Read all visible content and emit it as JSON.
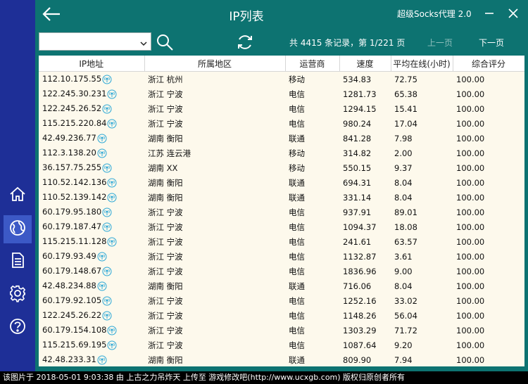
{
  "window": {
    "title": "IP列表",
    "app_name": "超级Socks代理 2.0"
  },
  "colors": {
    "sidebar": "#1e2f97",
    "header": "#0d7371",
    "row_bg": "#fdf9ec"
  },
  "sidebar": {
    "items": [
      {
        "name": "home-icon",
        "active": false
      },
      {
        "name": "globe-icon",
        "active": true
      },
      {
        "name": "document-icon",
        "active": false
      },
      {
        "name": "gear-icon",
        "active": false
      },
      {
        "name": "help-icon",
        "active": false
      }
    ]
  },
  "toolbar": {
    "filter_value": "",
    "record_info": "共 4415 条记录，第 1/221 页",
    "prev_label": "上一页",
    "next_label": "下一页"
  },
  "table": {
    "columns": [
      "IP地址",
      "所属地区",
      "运营商",
      "速度",
      "平均在线(小时)",
      "综合评分"
    ],
    "rows": [
      {
        "ip": "112.10.175.55",
        "region": "浙江 杭州",
        "isp": "移动",
        "speed": "534.83",
        "online": "72.75",
        "score": "100.00"
      },
      {
        "ip": "122.245.30.231",
        "region": "浙江 宁波",
        "isp": "电信",
        "speed": "1281.73",
        "online": "65.38",
        "score": "100.00"
      },
      {
        "ip": "122.245.26.52",
        "region": "浙江 宁波",
        "isp": "电信",
        "speed": "1294.15",
        "online": "15.41",
        "score": "100.00"
      },
      {
        "ip": "115.215.220.84",
        "region": "浙江 宁波",
        "isp": "电信",
        "speed": "980.24",
        "online": "17.04",
        "score": "100.00"
      },
      {
        "ip": "42.49.236.77",
        "region": "湖南 衡阳",
        "isp": "联通",
        "speed": "841.28",
        "online": "7.98",
        "score": "100.00"
      },
      {
        "ip": "112.3.138.20",
        "region": "江苏 连云港",
        "isp": "移动",
        "speed": "314.82",
        "online": "2.00",
        "score": "100.00"
      },
      {
        "ip": "36.157.75.255",
        "region": "湖南 XX",
        "isp": "移动",
        "speed": "550.15",
        "online": "9.37",
        "score": "100.00"
      },
      {
        "ip": "110.52.142.136",
        "region": "湖南 衡阳",
        "isp": "联通",
        "speed": "694.31",
        "online": "8.04",
        "score": "100.00"
      },
      {
        "ip": "110.52.139.142",
        "region": "湖南 衡阳",
        "isp": "联通",
        "speed": "331.14",
        "online": "8.04",
        "score": "100.00"
      },
      {
        "ip": "60.179.95.180",
        "region": "浙江 宁波",
        "isp": "电信",
        "speed": "937.91",
        "online": "89.01",
        "score": "100.00"
      },
      {
        "ip": "60.179.187.47",
        "region": "浙江 宁波",
        "isp": "电信",
        "speed": "1094.37",
        "online": "18.08",
        "score": "100.00"
      },
      {
        "ip": "115.215.11.128",
        "region": "浙江 宁波",
        "isp": "电信",
        "speed": "241.61",
        "online": "63.57",
        "score": "100.00"
      },
      {
        "ip": "60.179.93.49",
        "region": "浙江 宁波",
        "isp": "电信",
        "speed": "1132.87",
        "online": "3.61",
        "score": "100.00"
      },
      {
        "ip": "60.179.148.67",
        "region": "浙江 宁波",
        "isp": "电信",
        "speed": "1836.96",
        "online": "9.00",
        "score": "100.00"
      },
      {
        "ip": "42.48.234.88",
        "region": "湖南 衡阳",
        "isp": "联通",
        "speed": "716.06",
        "online": "8.04",
        "score": "100.00"
      },
      {
        "ip": "60.179.92.105",
        "region": "浙江 宁波",
        "isp": "电信",
        "speed": "1252.16",
        "online": "33.02",
        "score": "100.00"
      },
      {
        "ip": "122.245.26.22",
        "region": "浙江 宁波",
        "isp": "电信",
        "speed": "1148.26",
        "online": "56.04",
        "score": "100.00"
      },
      {
        "ip": "60.179.154.108",
        "region": "浙江 宁波",
        "isp": "电信",
        "speed": "1303.29",
        "online": "71.72",
        "score": "100.00"
      },
      {
        "ip": "115.215.69.195",
        "region": "浙江 宁波",
        "isp": "电信",
        "speed": "1087.64",
        "online": "9.20",
        "score": "100.00"
      },
      {
        "ip": "42.48.233.31",
        "region": "湖南 衡阳",
        "isp": "联通",
        "speed": "809.90",
        "online": "7.94",
        "score": "100.00"
      }
    ]
  },
  "footer": {
    "text": "该图片于 2018-05-01 9:03:38 由 上古之力吊炸天 上传至 游戏修改吧(http://www.ucxgb.com) 版权归原创者所有"
  }
}
